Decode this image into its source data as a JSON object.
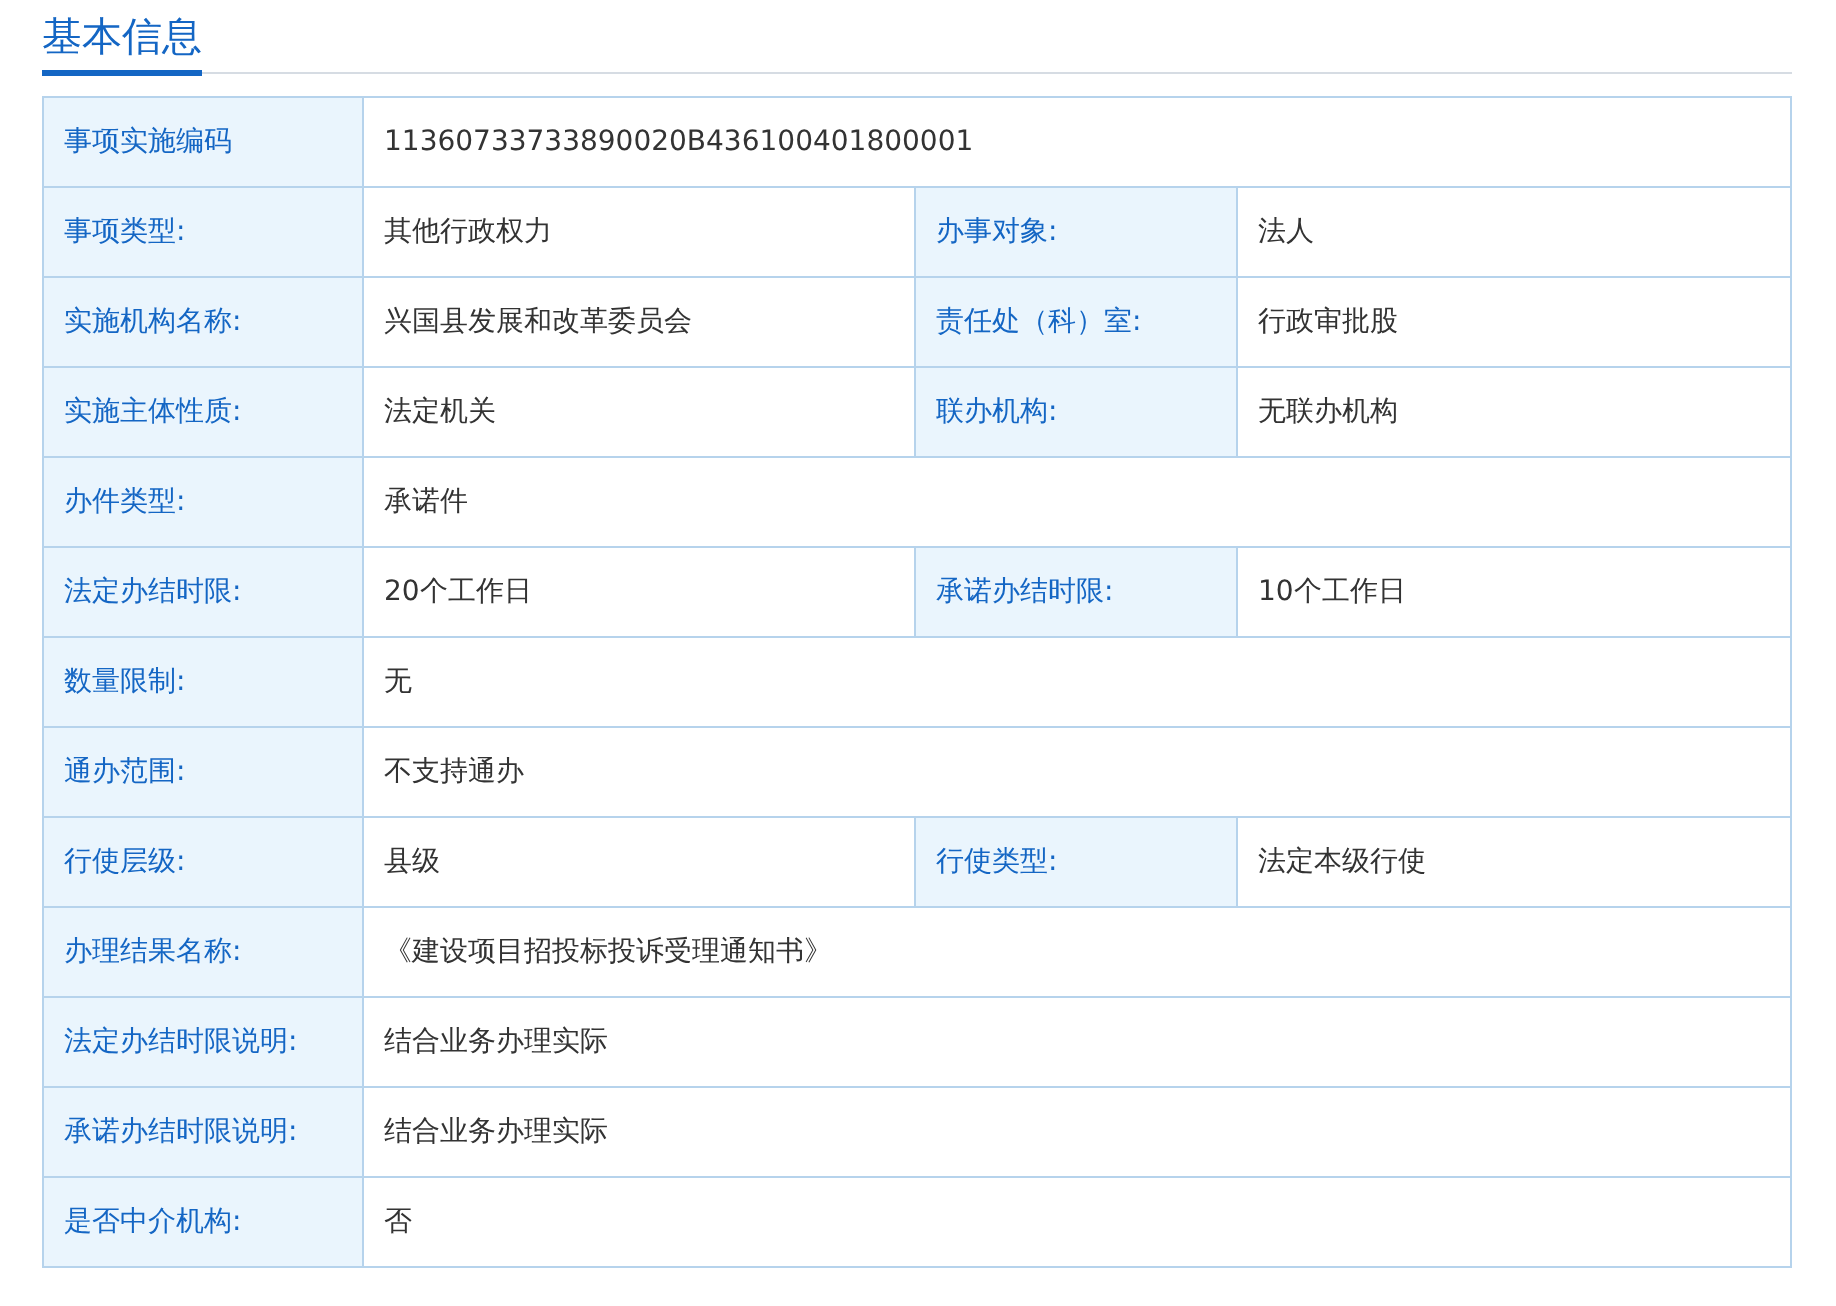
{
  "section_title": "基本信息",
  "rows": [
    {
      "fields": [
        {
          "label": "事项实施编码",
          "value": "11360733733890020B436100401800001"
        }
      ]
    },
    {
      "fields": [
        {
          "label": "事项类型:",
          "value": "其他行政权力"
        },
        {
          "label": "办事对象:",
          "value": "法人"
        }
      ]
    },
    {
      "fields": [
        {
          "label": "实施机构名称:",
          "value": "兴国县发展和改革委员会"
        },
        {
          "label": "责任处（科）室:",
          "value": "行政审批股"
        }
      ]
    },
    {
      "fields": [
        {
          "label": "实施主体性质:",
          "value": "法定机关"
        },
        {
          "label": "联办机构:",
          "value": "无联办机构"
        }
      ]
    },
    {
      "fields": [
        {
          "label": "办件类型:",
          "value": "承诺件"
        }
      ]
    },
    {
      "fields": [
        {
          "label": "法定办结时限:",
          "value": "20个工作日"
        },
        {
          "label": "承诺办结时限:",
          "value": "10个工作日"
        }
      ]
    },
    {
      "fields": [
        {
          "label": "数量限制:",
          "value": "无"
        }
      ]
    },
    {
      "fields": [
        {
          "label": "通办范围:",
          "value": "不支持通办"
        }
      ]
    },
    {
      "fields": [
        {
          "label": "行使层级:",
          "value": "县级"
        },
        {
          "label": "行使类型:",
          "value": "法定本级行使"
        }
      ]
    },
    {
      "fields": [
        {
          "label": "办理结果名称:",
          "value": "《建设项目招投标投诉受理通知书》"
        }
      ]
    },
    {
      "fields": [
        {
          "label": "法定办结时限说明:",
          "value": "结合业务办理实际"
        }
      ]
    },
    {
      "fields": [
        {
          "label": "承诺办结时限说明:",
          "value": "结合业务办理实际"
        }
      ]
    },
    {
      "fields": [
        {
          "label": "是否中介机构:",
          "value": "否"
        }
      ]
    }
  ]
}
